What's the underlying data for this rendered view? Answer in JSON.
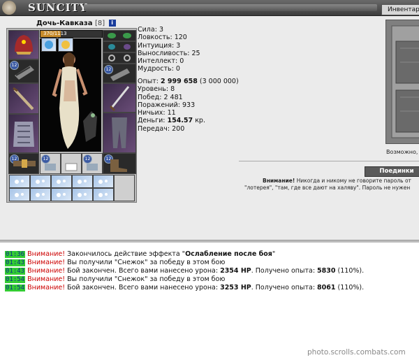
{
  "header": {
    "logo_text": "SUNCITY",
    "inventory_tab": "Инвентар"
  },
  "character": {
    "name": "Дочь-Кавказа",
    "level": "[8]",
    "info_icon": "i",
    "hp_text": "370/1113",
    "hp_fraction": 0.33
  },
  "stats": [
    {
      "label": "Сила:",
      "value": "3"
    },
    {
      "label": "Ловкость:",
      "value": "120"
    },
    {
      "label": "Интуиция:",
      "value": "3"
    },
    {
      "label": "Выносливость:",
      "value": "25"
    },
    {
      "label": "Интеллект:",
      "value": "0"
    },
    {
      "label": "Мудрость:",
      "value": "0"
    }
  ],
  "progress": {
    "exp_label": "Опыт:",
    "exp_value": "2 999 658",
    "exp_next": "(3 000 000)",
    "level_label": "Уровень:",
    "level_value": "8",
    "wins_label": "Побед:",
    "wins_value": "2 481",
    "losses_label": "Поражений:",
    "losses_value": "933",
    "draws_label": "Ничьих:",
    "draws_value": "11",
    "money_label": "Деньги:",
    "money_value": "154.57",
    "money_unit": "кр.",
    "transfers_label": "Передач:",
    "transfers_value": "200"
  },
  "location": {
    "caption": "Возможно,"
  },
  "fight_button": "Поединки",
  "warning": {
    "bold": "Внимание!",
    "line1": "Никогда и никому не говорите пароль от",
    "line2": "\"лотерея\", \"там, где все дают на халяву\". Пароль не нужен"
  },
  "chat": [
    {
      "time": "01:36",
      "warn": "Внимание!",
      "text_before": "Закончилось действие эффекта \"",
      "bold1": "Ослабление после боя",
      "text_mid": "\"",
      "bold2": "",
      "text_mid2": "",
      "bold3": "",
      "text_after": ""
    },
    {
      "time": "01:43",
      "warn": "Внимание!",
      "text_before": "Вы получили \"Снежок\" за победу в этом бою",
      "bold1": "",
      "text_mid": "",
      "bold2": "",
      "text_mid2": "",
      "bold3": "",
      "text_after": ""
    },
    {
      "time": "01:43",
      "warn": "Внимание!",
      "text_before": "Бой закончен. Всего вами нанесено урона: ",
      "bold1": "2354 HP",
      "text_mid": ". Получено опыта: ",
      "bold2": "5830",
      "text_mid2": " (110%).",
      "bold3": "",
      "text_after": ""
    },
    {
      "time": "01:54",
      "warn": "Внимание!",
      "text_before": "Вы получили \"Снежок\" за победу в этом бою",
      "bold1": "",
      "text_mid": "",
      "bold2": "",
      "text_mid2": "",
      "bold3": "",
      "text_after": ""
    },
    {
      "time": "01:54",
      "warn": "Внимание!",
      "text_before": "Бой закончен. Всего вами нанесено урона: ",
      "bold1": "3253 HP",
      "text_mid": ". Получено опыта: ",
      "bold2": "8061",
      "text_mid2": " (110%).",
      "bold3": "",
      "text_after": ""
    }
  ],
  "watermark": "photo.scrolls.combats.com",
  "slot_badges": {
    "b1": "12",
    "b2": "12",
    "b3": "12",
    "b4": "12",
    "b5": "12",
    "b6": "12"
  },
  "colors": {
    "timestamp_bg": "#33cc33",
    "warning_red": "#cc0000",
    "hp_bar": "#c68a2a"
  }
}
